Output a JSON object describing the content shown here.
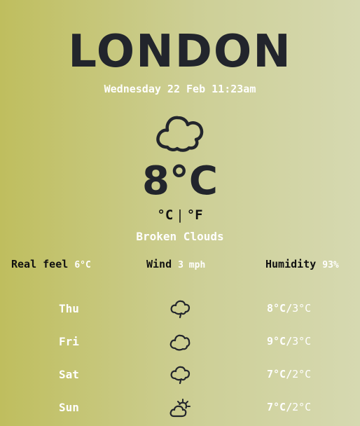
{
  "city": "LONDON",
  "datetime": "Wednesday 22 Feb 11:23am",
  "current": {
    "icon": "cloud-icon",
    "temperature": "8°C",
    "condition": "Broken Clouds"
  },
  "units": {
    "celsius": "°C",
    "separator": "|",
    "fahrenheit": "°F"
  },
  "stats": {
    "real_feel_label": "Real feel",
    "real_feel_value": "6°C",
    "wind_label": "Wind",
    "wind_value": "3 mph",
    "humidity_label": "Humidity",
    "humidity_value": "93%"
  },
  "forecast": [
    {
      "day": "Thu",
      "icon": "rain-cloud-icon",
      "high": "8°C",
      "sep": "/",
      "low": "3°C"
    },
    {
      "day": "Fri",
      "icon": "cloud-icon",
      "high": "9°C",
      "sep": "/",
      "low": "3°C"
    },
    {
      "day": "Sat",
      "icon": "rain-cloud-icon",
      "high": "7°C",
      "sep": "/",
      "low": "2°C"
    },
    {
      "day": "Sun",
      "icon": "sun-cloud-icon",
      "high": "7°C",
      "sep": "/",
      "low": "2°C"
    }
  ],
  "colors": {
    "dark_text": "#22252c",
    "light_text": "#ffffff",
    "bg_left": "#bfbe5e",
    "bg_right": "#d6d9b1"
  }
}
